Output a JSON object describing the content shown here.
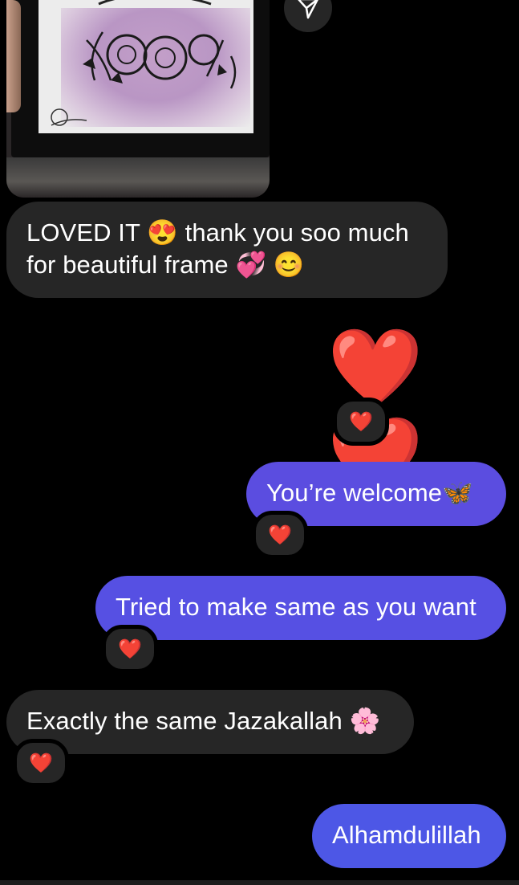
{
  "messages": {
    "m1": {
      "text": "LOVED IT 😍 thank you soo much for beautiful frame 💞 😊"
    },
    "m2": {
      "text": "❤️❤️",
      "reaction": "❤️"
    },
    "m3": {
      "text": "You’re welcome🦋",
      "reaction": "❤️"
    },
    "m4": {
      "text": "Tried to make same as you want",
      "reaction": "❤️"
    },
    "m5": {
      "text": "Exactly the same Jazakallah 🌸",
      "reaction": "❤️"
    },
    "m6": {
      "text": "Alhamdulillah"
    }
  },
  "icons": {
    "share": "paper-plane-icon",
    "reaction": "heart-icon"
  },
  "colors": {
    "background": "#000000",
    "received_bubble": "#262626",
    "sent_bubble": "#5a4cdf",
    "sent_bubble_alt": "#4f55e6"
  }
}
